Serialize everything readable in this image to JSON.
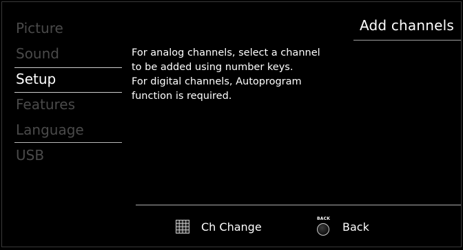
{
  "menu": {
    "items": [
      {
        "label": "Picture"
      },
      {
        "label": "Sound"
      },
      {
        "label": "Setup"
      },
      {
        "label": "Features"
      },
      {
        "label": "Language"
      },
      {
        "label": "USB"
      }
    ],
    "selected": "Setup"
  },
  "panel": {
    "title": "Add channels",
    "description_lines": [
      "For analog channels, select a channel",
      "to be added using number keys.",
      "For digital channels, Autoprogram",
      "function is required."
    ]
  },
  "footer": {
    "ch_change_label": "Ch Change",
    "back_label": "Back",
    "back_icon_text": "BACK",
    "ch_change_icon": "grid-keypad-icon",
    "back_icon": "back-button-icon"
  },
  "colors": {
    "background": "#000000",
    "active_text": "#ffffff",
    "inactive_text": "#4a4a4a"
  }
}
